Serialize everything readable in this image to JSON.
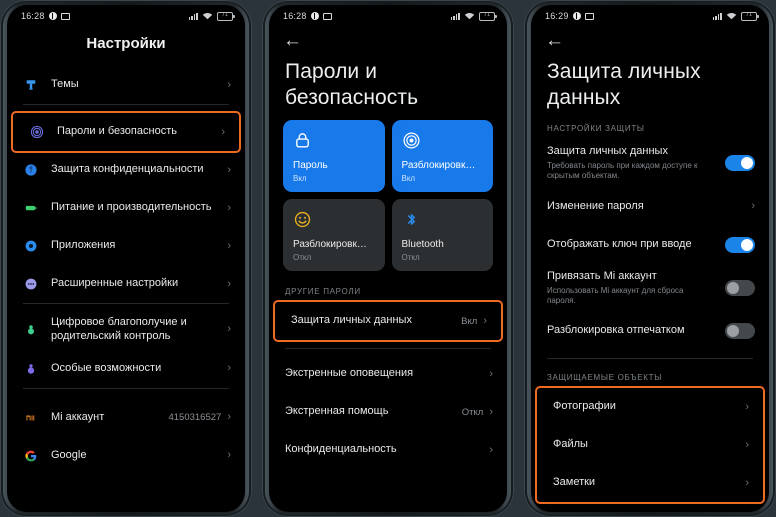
{
  "meta": {
    "background_color": "#2b343a",
    "highlight_color": "#ec6a21",
    "accent_blue": "#1879ea"
  },
  "phones": [
    {
      "id": "phone-settings-root",
      "status_bar": {
        "time": "16:28",
        "battery_text": "71"
      },
      "header": {
        "title": "Настройки"
      },
      "groups": [
        {
          "rows": [
            {
              "icon": "theme-brush-icon",
              "icon_color": "#3897f0",
              "title": "Темы",
              "value": "",
              "chevron": "›",
              "highlight": false
            }
          ]
        },
        {
          "rows": [
            {
              "icon": "fingerprint-icon",
              "icon_color": "#6a6fe0",
              "title": "Пароли и безопасность",
              "value": "",
              "chevron": "›",
              "highlight": true
            },
            {
              "icon": "privacy-shield-icon",
              "icon_color": "#2a7fe8",
              "title": "Защита конфиденциальности",
              "value": "",
              "chevron": "›",
              "highlight": false
            },
            {
              "icon": "battery-icon",
              "icon_color": "#3ecf6e",
              "title": "Питание и производительность",
              "value": "",
              "chevron": "›",
              "highlight": false
            },
            {
              "icon": "apps-gear-icon",
              "icon_color": "#2a8cf0",
              "title": "Приложения",
              "value": "",
              "chevron": "›",
              "highlight": false
            },
            {
              "icon": "more-dots-icon",
              "icon_color": "#9a9ae8",
              "title": "Расширенные настройки",
              "value": "",
              "chevron": "›",
              "highlight": false
            }
          ]
        },
        {
          "rows": [
            {
              "icon": "digital-wellbeing-icon",
              "icon_color": "#3ecf8e",
              "title": "Цифровое благополучие и родительский контроль",
              "value": "",
              "chevron": "›",
              "highlight": false
            },
            {
              "icon": "accessibility-icon",
              "icon_color": "#7a6ae8",
              "title": "Особые возможности",
              "value": "",
              "chevron": "›",
              "highlight": false
            }
          ]
        },
        {
          "rows": [
            {
              "icon": "mi-logo-icon",
              "icon_color": "#f28c28",
              "title": "Mi аккаунт",
              "value": "4150316527",
              "chevron": "›",
              "highlight": false
            },
            {
              "icon": "google-logo-icon",
              "icon_color": "#4285f4",
              "title": "Google",
              "value": "",
              "chevron": "›",
              "highlight": false
            }
          ]
        }
      ]
    },
    {
      "id": "phone-passwords-security",
      "status_bar": {
        "time": "16:28",
        "battery_text": "71"
      },
      "header": {
        "back": "←",
        "title": "Пароли и безопасность"
      },
      "tiles": [
        {
          "icon": "lock-icon",
          "label": "Пароль",
          "state": "Вкл",
          "active": true
        },
        {
          "icon": "fingerprint-icon",
          "label": "Разблокировк…",
          "state": "Вкл",
          "active": true
        },
        {
          "icon": "face-unlock-icon",
          "label": "Разблокировк…",
          "state": "Откл",
          "active": false
        },
        {
          "icon": "bluetooth-icon",
          "label": "Bluetooth",
          "state": "Откл",
          "active": false
        }
      ],
      "section_label": "ДРУГИЕ ПАРОЛИ",
      "groups": [
        {
          "rows": [
            {
              "title": "Защита личных данных",
              "value": "Вкл",
              "chevron": "›",
              "highlight": true
            }
          ]
        },
        {
          "rows": [
            {
              "title": "Экстренные оповещения",
              "value": "",
              "chevron": "›",
              "highlight": false
            },
            {
              "title": "Экстренная помощь",
              "value": "Откл",
              "chevron": "›",
              "highlight": false
            },
            {
              "title": "Конфиденциальность",
              "value": "",
              "chevron": "›",
              "highlight": false
            }
          ]
        }
      ]
    },
    {
      "id": "phone-personal-data-protection",
      "status_bar": {
        "time": "16:29",
        "battery_text": "71"
      },
      "header": {
        "back": "←",
        "title": "Защита личных данных"
      },
      "section_label_1": "НАСТРОЙКИ ЗАЩИТЫ",
      "settings_rows": [
        {
          "title": "Защита личных данных",
          "subtitle": "Требовать пароль при каждом доступе к скрытым объектам.",
          "control": "toggle",
          "toggle_on": true
        },
        {
          "title": "Изменение пароля",
          "subtitle": "",
          "control": "chevron",
          "chevron": "›"
        },
        {
          "title": "Отображать ключ при вводе",
          "subtitle": "",
          "control": "toggle",
          "toggle_on": true
        },
        {
          "title": "Привязать Mi аккаунт",
          "subtitle": "Использовать Mi аккаунт для сброса пароля.",
          "control": "toggle",
          "toggle_on": false
        },
        {
          "title": "Разблокировка отпечатком",
          "subtitle": "",
          "control": "toggle",
          "toggle_on": false
        }
      ],
      "section_label_2": "ЗАЩИЩАЕМЫЕ ОБЪЕКТЫ",
      "protected_rows": [
        {
          "title": "Фотографии",
          "chevron": "›"
        },
        {
          "title": "Файлы",
          "chevron": "›"
        },
        {
          "title": "Заметки",
          "chevron": "›"
        }
      ]
    }
  ]
}
